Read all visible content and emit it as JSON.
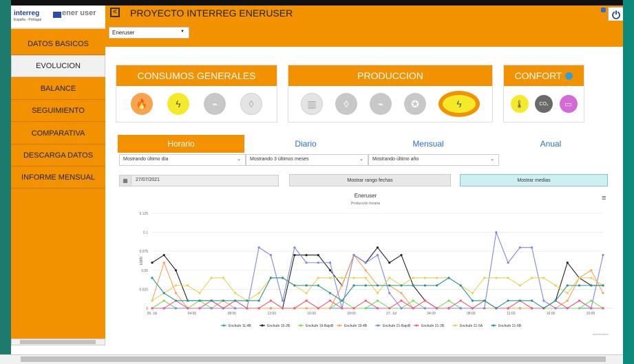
{
  "app": {
    "title": "PROYECTO INTERREG ENERUSER",
    "logo_interreg": "interreg",
    "logo_sub": "España - Portugal",
    "logo_ener": "ener user",
    "power_icon": "power-icon"
  },
  "project_select": {
    "value": "Eneruser"
  },
  "sidebar": {
    "items": [
      {
        "label": "DATOS BASICOS"
      },
      {
        "label": "EVOLUCION",
        "active": true
      },
      {
        "label": "BALANCE"
      },
      {
        "label": "SEGUIMIENTO"
      },
      {
        "label": "COMPARATIVA"
      },
      {
        "label": "DESCARGA DATOS"
      },
      {
        "label": "INFORME MENSUAL"
      }
    ]
  },
  "panels": {
    "consumos": {
      "title": "CONSUMOS GENERALES",
      "icons": [
        "fire-icon",
        "lightning-icon",
        "plug-icon",
        "water-drop-icon"
      ]
    },
    "produccion": {
      "title": "PRODUCCION",
      "icons": [
        "radiator-icon",
        "water-drop-icon",
        "plug-icon",
        "bulb-icon",
        "lightning-icon"
      ]
    },
    "confort": {
      "title": "CONFORT",
      "icons": [
        "thermometer-icon",
        "co2-icon",
        "display-icon"
      ]
    }
  },
  "tabs": [
    {
      "label": "Horario",
      "active": true
    },
    {
      "label": "Diario"
    },
    {
      "label": "Mensual"
    },
    {
      "label": "Anual"
    }
  ],
  "selects": {
    "horario": "Mostrando último día",
    "diario": "Mostrando 3 últimos meses",
    "mensual": "Mostrando último año"
  },
  "date_field": {
    "value": "27/07/2021"
  },
  "buttons": {
    "rango": "Mostrar rango fechas",
    "medias": "Mostrar medias"
  },
  "chart_data": {
    "type": "line",
    "title": "Eneruser",
    "subtitle": "Producción horaria",
    "ylabel": "kWh",
    "ylim": [
      0,
      0.125
    ],
    "yticks": [
      "0",
      "0.025",
      "0.05",
      "0.075",
      "0.1",
      "0.125"
    ],
    "xticks": [
      "26. Jul",
      "04:00",
      "08:00",
      "12:00",
      "16:00",
      "20:00",
      "27. Jul",
      "04:00",
      "08:00",
      "12:00",
      "16:00",
      "20:00",
      "28. Jul"
    ],
    "x": [
      0,
      1,
      2,
      3,
      4,
      5,
      6,
      7,
      8,
      9,
      10,
      11,
      12,
      13,
      14,
      15,
      16,
      17,
      18,
      19,
      20,
      21,
      22,
      23,
      24,
      25,
      26,
      27,
      28,
      29,
      30,
      31,
      32,
      33,
      34,
      35,
      36,
      37,
      38
    ],
    "series": [
      {
        "name": "Enchufe 11-4B",
        "color": "#2f9fd8",
        "values": [
          0,
          0,
          0,
          0,
          0,
          0,
          0,
          0,
          0,
          0,
          0,
          0,
          0,
          0,
          0,
          0,
          0,
          0,
          0,
          0,
          0,
          0,
          0,
          0,
          0,
          0,
          0,
          0,
          0,
          0,
          0,
          0,
          0,
          0,
          0,
          0,
          0,
          0,
          0
        ]
      },
      {
        "name": "Enchufe 15-2B",
        "color": "#222222",
        "values": [
          0.06,
          0.07,
          0.05,
          0.01,
          0.01,
          0.01,
          0,
          0,
          0,
          0,
          0,
          0,
          0.07,
          0.07,
          0.07,
          0.05,
          0.03,
          0.07,
          0.06,
          0.08,
          0.06,
          0.07,
          0.03,
          0.01,
          0,
          0,
          0,
          0,
          0,
          0,
          0,
          0,
          0,
          0,
          0.01,
          0.06,
          0.04,
          0.03,
          0.03
        ]
      },
      {
        "name": "Enchufe 19-BajoB",
        "color": "#7ed957",
        "values": [
          0,
          0.01,
          0,
          0,
          0.01,
          0,
          0,
          0.01,
          0,
          0,
          0.01,
          0,
          0,
          0.01,
          0,
          0,
          0.01,
          0,
          0,
          0.01,
          0,
          0,
          0.01,
          0,
          0,
          0.01,
          0,
          0,
          0.01,
          0,
          0,
          0.01,
          0,
          0,
          0.01,
          0,
          0,
          0.01,
          0
        ]
      },
      {
        "name": "Enchufe 19-4B",
        "color": "#f7a35c",
        "values": [
          0.01,
          0.06,
          0.02,
          0,
          0,
          0,
          0.01,
          0,
          0,
          0,
          0,
          0,
          0,
          0,
          0,
          0,
          0.03,
          0.07,
          0.05,
          0.03,
          0.03,
          0.02,
          0,
          0,
          0,
          0,
          0,
          0,
          0,
          0,
          0,
          0,
          0,
          0,
          0,
          0.01,
          0.04,
          0.05,
          0.02
        ]
      },
      {
        "name": "Enchufe 21-BajoB",
        "color": "#8085e9",
        "values": [
          0,
          0,
          0,
          0,
          0,
          0,
          0,
          0,
          0,
          0.08,
          0.07,
          0.01,
          0.08,
          0.06,
          0.06,
          0.06,
          0,
          0.07,
          0.06,
          0.07,
          0.02,
          0,
          0,
          0,
          0,
          0,
          0,
          0,
          0,
          0.1,
          0.06,
          0.08,
          0.08,
          0.01,
          0,
          0,
          0.01,
          0,
          0.07
        ]
      },
      {
        "name": "Enchufe 21-2B",
        "color": "#f15c80",
        "values": [
          0,
          0,
          0.01,
          0,
          0,
          0.01,
          0,
          0.01,
          0,
          0,
          0.01,
          0,
          0,
          0.01,
          0,
          0.01,
          0,
          0,
          0.01,
          0,
          0,
          0.01,
          0,
          0.01,
          0,
          0,
          0.01,
          0,
          0.01,
          0,
          0,
          0.01,
          0,
          0,
          0.01,
          0,
          0.01,
          0,
          0
        ]
      },
      {
        "name": "Enchufe 21-5A",
        "color": "#e4d354",
        "values": [
          0.01,
          0.02,
          0.03,
          0.03,
          0.02,
          0.04,
          0.04,
          0.02,
          0.01,
          0.02,
          0.04,
          0.04,
          0.03,
          0.02,
          0.04,
          0.04,
          0.04,
          0.04,
          0.04,
          0.02,
          0.04,
          0.03,
          0.04,
          0.04,
          0.04,
          0.04,
          0.03,
          0.02,
          0.04,
          0.04,
          0.04,
          0.03,
          0.04,
          0.04,
          0.03,
          0.02,
          0.04,
          0.04,
          0.03
        ]
      },
      {
        "name": "Enchufe 21-5B",
        "color": "#2b908f",
        "values": [
          0.04,
          0.02,
          0.01,
          0.01,
          0.01,
          0.01,
          0.01,
          0.01,
          0.01,
          0.01,
          0.04,
          0.04,
          0.03,
          0.03,
          0.03,
          0.02,
          0.01,
          0.03,
          0.03,
          0.03,
          0.03,
          0.03,
          0.03,
          0.03,
          0.03,
          0.04,
          0.03,
          0.01,
          0.01,
          0,
          0.01,
          0.01,
          0.01,
          0,
          0.01,
          0.03,
          0.03,
          0.03,
          0.03
        ]
      }
    ],
    "legend_position": "bottom",
    "credit": "www.ideulis.es"
  }
}
